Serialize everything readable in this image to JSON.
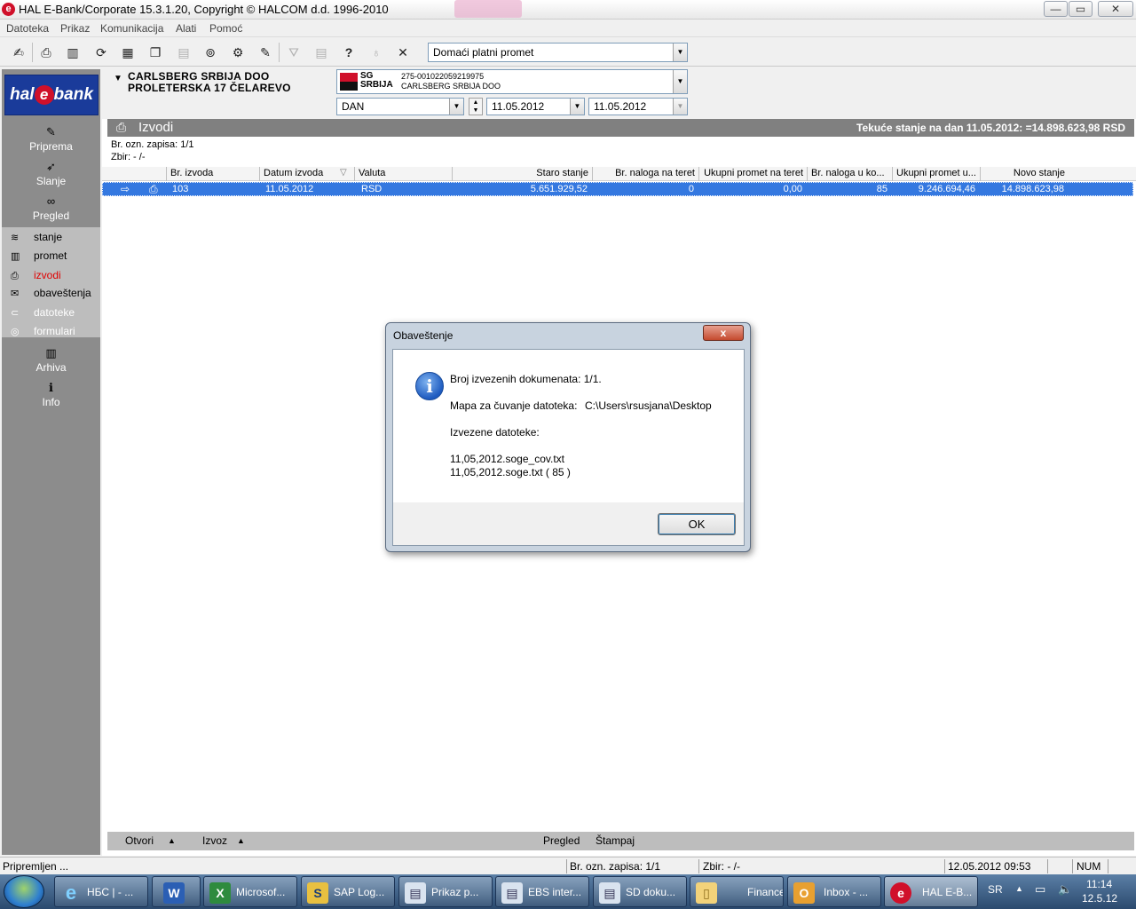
{
  "window": {
    "title": "HAL E-Bank/Corporate 15.3.1.20, Copyright © HALCOM d.d. 1996-2010",
    "minimize": "—",
    "restore": "▭",
    "close": "✕"
  },
  "menu": [
    "Datoteka",
    "Prikaz",
    "Komunikacija",
    "Alati",
    "Pomoć"
  ],
  "toolbar": {
    "payment_type": "Domaći platni promet"
  },
  "sidebar": {
    "logo": {
      "pre": "hal",
      "e": "e",
      "post": "bank"
    },
    "top": [
      {
        "label": "Priprema",
        "icon": "pencil-pad-icon"
      },
      {
        "label": "Slanje",
        "icon": "send-icon"
      },
      {
        "label": "Pregled",
        "icon": "binoculars-icon"
      }
    ],
    "sub": [
      {
        "label": "stanje",
        "icon": "coins-icon",
        "color": "#000000"
      },
      {
        "label": "promet",
        "icon": "abacus-icon",
        "color": "#000000"
      },
      {
        "label": "izvodi",
        "icon": "printer-icon",
        "color": "#e00000"
      },
      {
        "label": "obaveštenja",
        "icon": "envelope-icon",
        "color": "#000000"
      },
      {
        "label": "datoteke",
        "icon": "files-icon",
        "color": "#ffffff"
      },
      {
        "label": "formulari",
        "icon": "forms-icon",
        "color": "#ffffff"
      }
    ],
    "bottom": [
      {
        "label": "Arhiva",
        "icon": "archive-icon"
      },
      {
        "label": "Info",
        "icon": "info-icon"
      }
    ]
  },
  "company": {
    "name": "CARLSBERG SRBIJA DOO",
    "address": "PROLETERSKA 17 ČELAREVO"
  },
  "bank": {
    "sg_line1": "SG",
    "sg_line2": "SRBIJA",
    "account": "275-0010220592199​75",
    "holder": "CARLSBERG SRBIJA DOO"
  },
  "period": {
    "unit": "DAN",
    "from": "11.05.2012",
    "to": "11.05.2012"
  },
  "izvodi": {
    "title": "Izvodi",
    "balance": "Tekuće stanje na dan 11.05.2012: =14.898.623,98 RSD",
    "record_info": "Br. ozn. zapisa: 1/1",
    "sum_info": "Zbir: - /-"
  },
  "grid": {
    "columns": [
      "Br. izvoda",
      "Datum izvoda",
      "Valuta",
      "Staro stanje",
      "Br. naloga na teret",
      "Ukupni promet na teret",
      "Br. naloga u ko...",
      "Ukupni promet u...",
      "Novo stanje"
    ],
    "rows": [
      {
        "br": "103",
        "datum": "11.05.2012",
        "valuta": "RSD",
        "staro": "5.651.929,52",
        "nal_teret": "0",
        "prom_teret": "0,00",
        "nal_korist": "85",
        "prom_korist": "9.246.694,46",
        "novo": "14.898.623,98"
      }
    ]
  },
  "bottombar": {
    "open": "Otvori",
    "export": "Izvoz",
    "preview": "Pregled",
    "print": "Štampaj"
  },
  "status": {
    "ready": "Pripremljen ...",
    "record": "Br. ozn. zapisa: 1/1",
    "sum": "Zbir: - /-",
    "datetime": "12.05.2012 09:53",
    "num": "NUM"
  },
  "dialog": {
    "title": "Obaveštenje",
    "close": "x",
    "line1": "Broj izvezenih dokumenata:  1/1.",
    "line2_label": "Mapa za čuvanje datoteka:",
    "line2_value": "C:\\Users\\rsusjana\\Desktop",
    "line3": "Izvezene datoteke:",
    "file1": "11,05,2012.soge_cov.txt",
    "file2": "11,05,2012.soge.txt  ( 85 )",
    "ok": "OK"
  },
  "taskbar": {
    "items": [
      {
        "label": "НБС | - ...",
        "icon": "internet-explorer-icon"
      },
      {
        "label": "",
        "icon": "word-icon"
      },
      {
        "label": "Microsof...",
        "icon": "excel-icon"
      },
      {
        "label": "SAP Log...",
        "icon": "sap-icon"
      },
      {
        "label": "Prikaz p...",
        "icon": "window-icon"
      },
      {
        "label": "EBS inter...",
        "icon": "window-icon"
      },
      {
        "label": "SD doku...",
        "icon": "window-icon"
      },
      {
        "label": "Finance_...",
        "icon": "folder-icon"
      },
      {
        "label": "Inbox - ...",
        "icon": "outlook-icon"
      },
      {
        "label": "HAL E-B...",
        "icon": "hal-ebank-icon"
      }
    ],
    "lang": "SR",
    "time": "11:14",
    "date": "12.5.12"
  }
}
